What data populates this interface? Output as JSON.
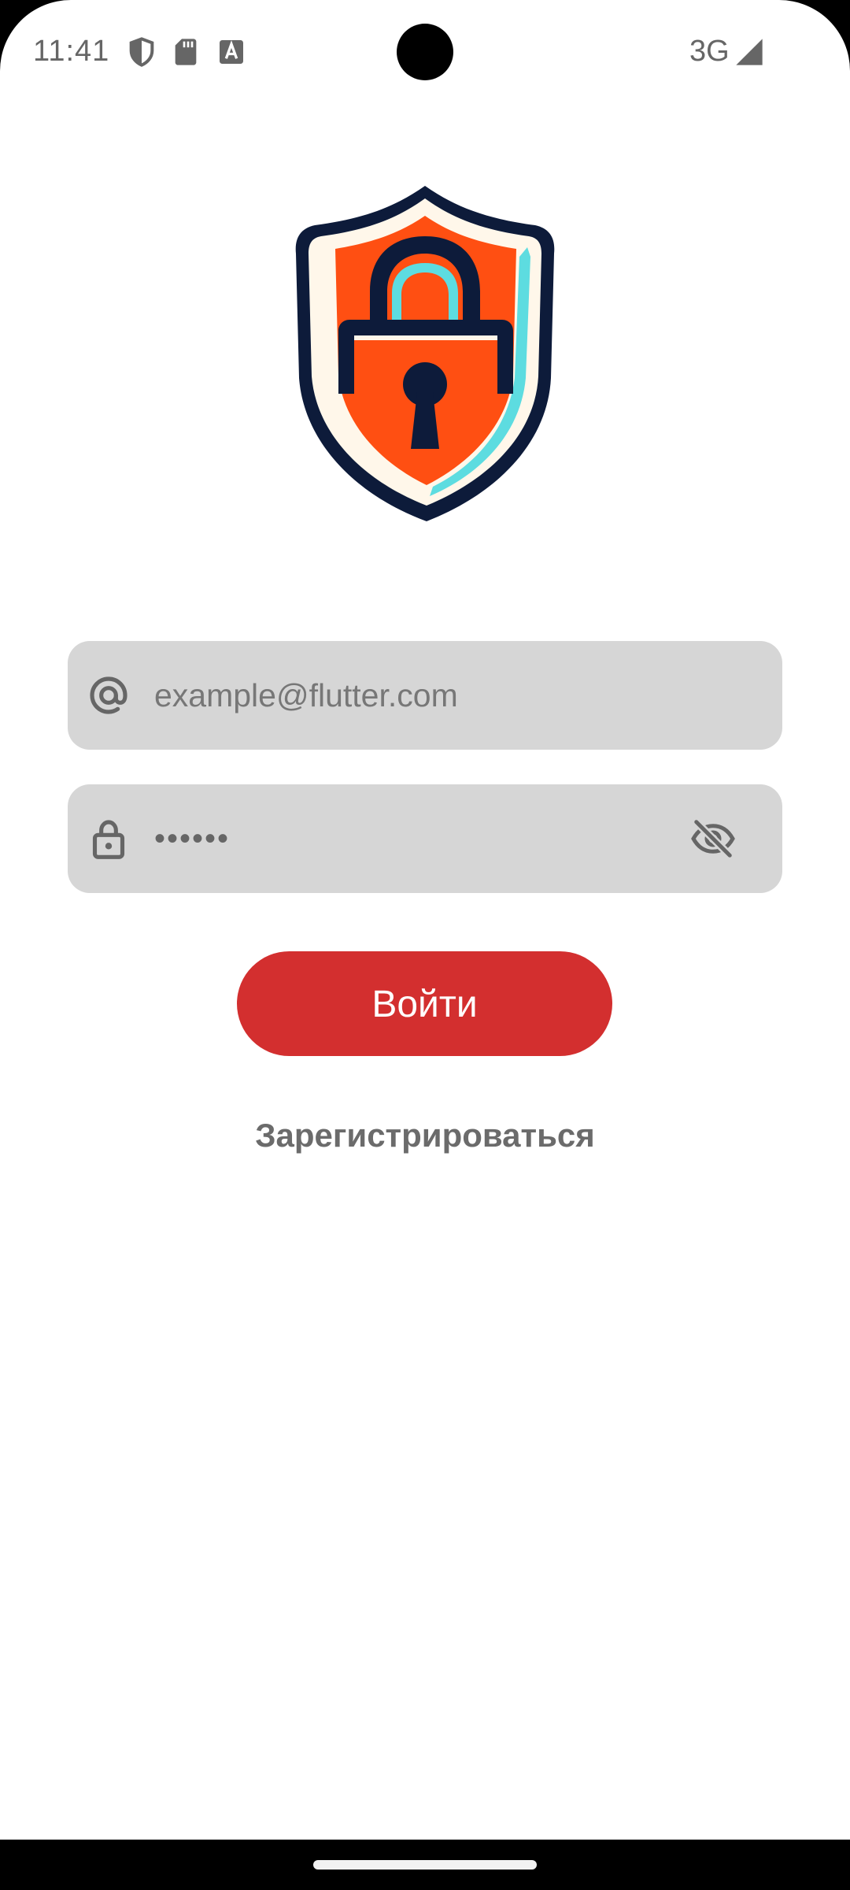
{
  "status_bar": {
    "time": "11:41",
    "network": "3G",
    "icons": [
      "shield-icon",
      "sd-card-icon",
      "text-notification-icon",
      "signal-icon"
    ]
  },
  "logo": {
    "icon": "shield-lock-logo",
    "colors": {
      "shield": "#ff4f12",
      "outline": "#0d1b3a",
      "rim": "#fff7ea",
      "accent": "#5ddce0"
    }
  },
  "email_field": {
    "icon": "at-icon",
    "placeholder": "example@flutter.com",
    "value": ""
  },
  "password_field": {
    "icon": "lock-icon",
    "value": "••••••",
    "toggle_icon": "eye-off-icon"
  },
  "login_button": {
    "label": "Войти",
    "color": "#d32f2f"
  },
  "register_link": {
    "label": "Зарегистрироваться"
  }
}
